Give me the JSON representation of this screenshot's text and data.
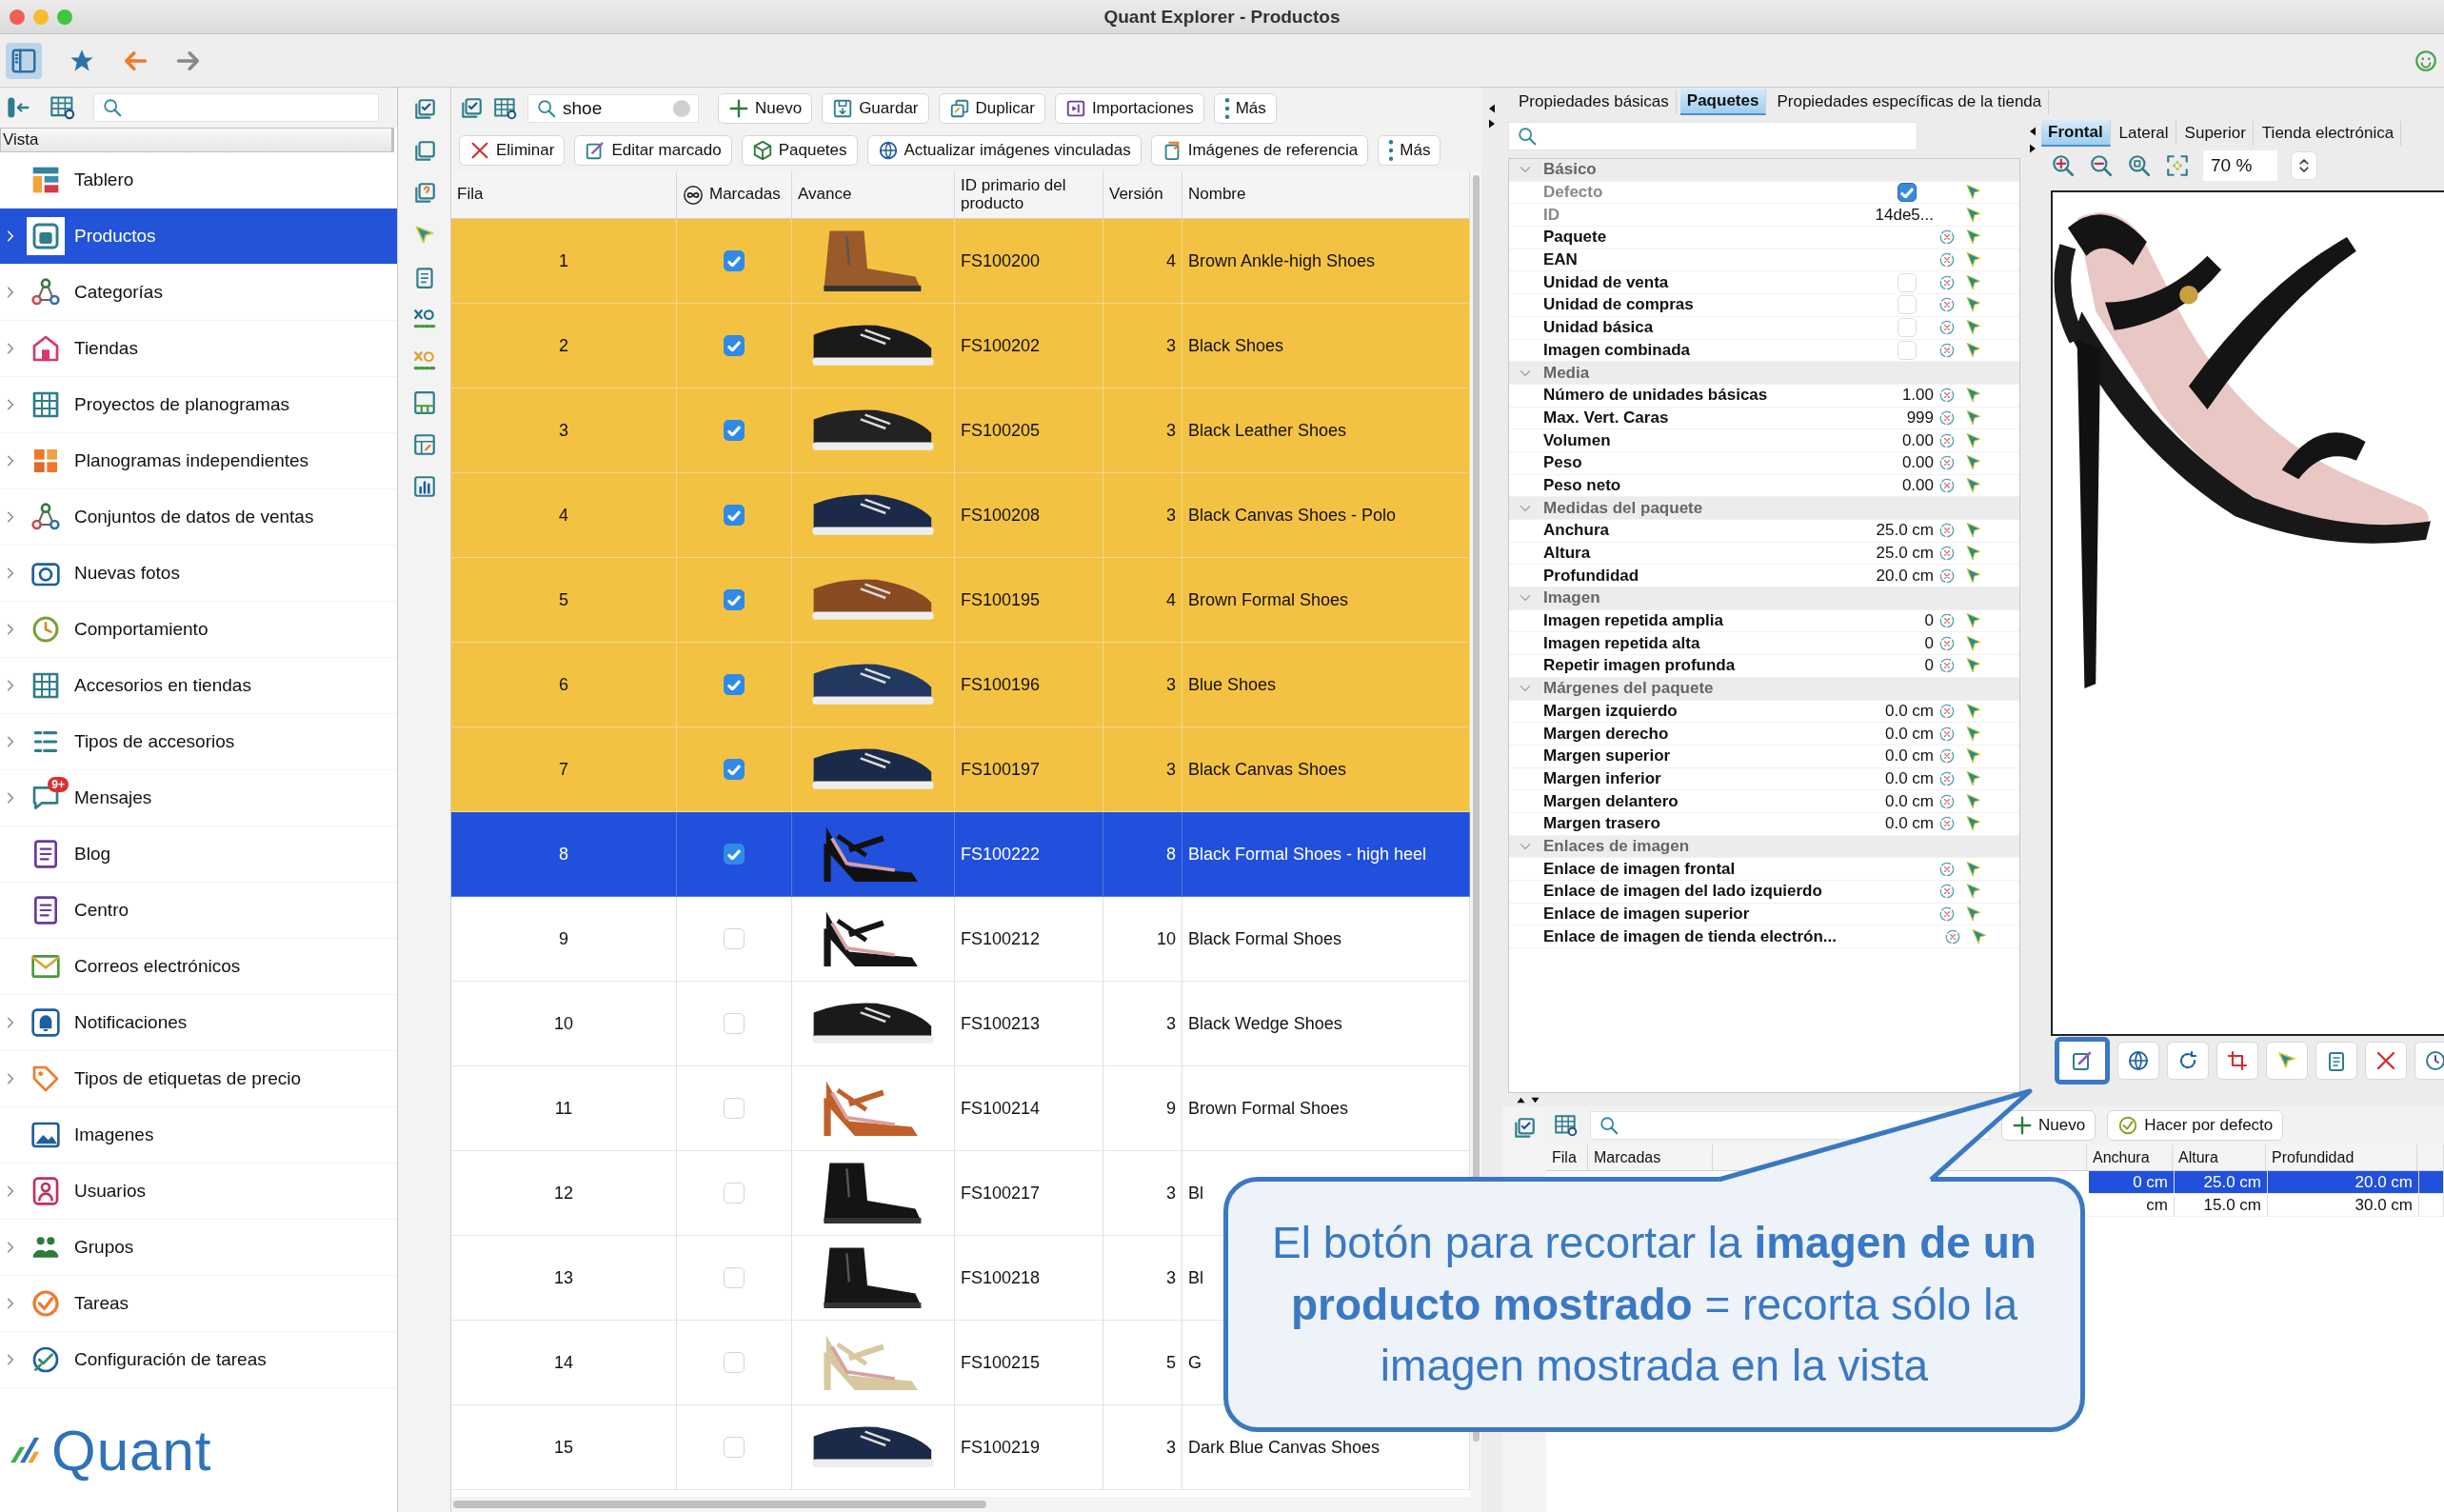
{
  "window": {
    "title": "Quant Explorer - Productos"
  },
  "sidebar": {
    "header": "Vista",
    "items": [
      {
        "label": "Tablero",
        "selected": false,
        "expandable": false
      },
      {
        "label": "Productos",
        "selected": true,
        "expandable": true
      },
      {
        "label": "Categorías",
        "selected": false,
        "expandable": true
      },
      {
        "label": "Tiendas",
        "selected": false,
        "expandable": true
      },
      {
        "label": "Proyectos de planogramas",
        "selected": false,
        "expandable": true
      },
      {
        "label": "Planogramas independientes",
        "selected": false,
        "expandable": true
      },
      {
        "label": "Conjuntos de datos de ventas",
        "selected": false,
        "expandable": true
      },
      {
        "label": "Nuevas fotos",
        "selected": false,
        "expandable": true
      },
      {
        "label": "Comportamiento",
        "selected": false,
        "expandable": true
      },
      {
        "label": "Accesorios en tiendas",
        "selected": false,
        "expandable": true
      },
      {
        "label": "Tipos de accesorios",
        "selected": false,
        "expandable": true
      },
      {
        "label": "Mensajes",
        "selected": false,
        "expandable": true,
        "badge": "9+"
      },
      {
        "label": "Blog",
        "selected": false,
        "expandable": false
      },
      {
        "label": "Centro",
        "selected": false,
        "expandable": false
      },
      {
        "label": "Correos electrónicos",
        "selected": false,
        "expandable": false
      },
      {
        "label": "Notificaciones",
        "selected": false,
        "expandable": true
      },
      {
        "label": "Tipos de etiquetas de precio",
        "selected": false,
        "expandable": true
      },
      {
        "label": "Imagenes",
        "selected": false,
        "expandable": false
      },
      {
        "label": "Usuarios",
        "selected": false,
        "expandable": true
      },
      {
        "label": "Grupos",
        "selected": false,
        "expandable": true
      },
      {
        "label": "Tareas",
        "selected": false,
        "expandable": true
      },
      {
        "label": "Configuración de tareas",
        "selected": false,
        "expandable": true
      }
    ],
    "logo": "Quant"
  },
  "products": {
    "search": {
      "value": "shoe"
    },
    "toolbar_1": [
      "Nuevo",
      "Guardar",
      "Duplicar",
      "Importaciones",
      "Más"
    ],
    "toolbar_2": [
      "Eliminar",
      "Editar marcado",
      "Paquetes",
      "Actualizar imágenes vinculadas",
      "Imágenes de referencia",
      "Más"
    ],
    "columns": [
      "Fila",
      "Marcadas",
      "Avance",
      "ID primario del producto",
      "Versión",
      "Nombre"
    ],
    "rows": [
      {
        "fila": "1",
        "marked": true,
        "selected": false,
        "id": "FS100200",
        "version": "4",
        "name": "Brown Ankle-high Shoes"
      },
      {
        "fila": "2",
        "marked": true,
        "selected": false,
        "id": "FS100202",
        "version": "3",
        "name": "Black Shoes"
      },
      {
        "fila": "3",
        "marked": true,
        "selected": false,
        "id": "FS100205",
        "version": "3",
        "name": "Black Leather Shoes"
      },
      {
        "fila": "4",
        "marked": true,
        "selected": false,
        "id": "FS100208",
        "version": "3",
        "name": "Black Canvas Shoes - Polo"
      },
      {
        "fila": "5",
        "marked": true,
        "selected": false,
        "id": "FS100195",
        "version": "4",
        "name": "Brown Formal Shoes"
      },
      {
        "fila": "6",
        "marked": true,
        "selected": false,
        "id": "FS100196",
        "version": "3",
        "name": "Blue Shoes"
      },
      {
        "fila": "7",
        "marked": true,
        "selected": false,
        "id": "FS100197",
        "version": "3",
        "name": "Black Canvas Shoes"
      },
      {
        "fila": "8",
        "marked": true,
        "selected": true,
        "id": "FS100222",
        "version": "8",
        "name": "Black Formal Shoes - high heel"
      },
      {
        "fila": "9",
        "marked": false,
        "selected": false,
        "id": "FS100212",
        "version": "10",
        "name": "Black Formal Shoes"
      },
      {
        "fila": "10",
        "marked": false,
        "selected": false,
        "id": "FS100213",
        "version": "3",
        "name": "Black Wedge Shoes"
      },
      {
        "fila": "11",
        "marked": false,
        "selected": false,
        "id": "FS100214",
        "version": "9",
        "name": "Brown Formal Shoes"
      },
      {
        "fila": "12",
        "marked": false,
        "selected": false,
        "id": "FS100217",
        "version": "3",
        "name": "Bl"
      },
      {
        "fila": "13",
        "marked": false,
        "selected": false,
        "id": "FS100218",
        "version": "3",
        "name": "Bl"
      },
      {
        "fila": "14",
        "marked": false,
        "selected": false,
        "id": "FS100215",
        "version": "5",
        "name": "G"
      },
      {
        "fila": "15",
        "marked": false,
        "selected": false,
        "id": "FS100219",
        "version": "3",
        "name": "Dark Blue Canvas Shoes"
      }
    ]
  },
  "properties": {
    "tabs": [
      {
        "label": "Propiedades básicas",
        "selected": false
      },
      {
        "label": "Paquetes",
        "selected": true
      },
      {
        "label": "Propiedades específicas de la tienda",
        "selected": false
      }
    ],
    "groups": [
      {
        "label": "Básico",
        "expanded": true,
        "rows": [
          {
            "label": "Defecto",
            "kind": "checkbox",
            "checked": true,
            "disabled": true
          },
          {
            "label": "ID",
            "kind": "text",
            "value": "14de5...",
            "disabled": true
          },
          {
            "label": "Paquete",
            "kind": "text",
            "disabled": false
          },
          {
            "label": "EAN",
            "kind": "text",
            "disabled": false
          },
          {
            "label": "Unidad de venta",
            "kind": "checkbox",
            "checked": false,
            "disabled": false
          },
          {
            "label": "Unidad de compras",
            "kind": "checkbox",
            "checked": false,
            "disabled": false
          },
          {
            "label": "Unidad básica",
            "kind": "checkbox",
            "checked": false,
            "disabled": false
          },
          {
            "label": "Imagen combinada",
            "kind": "checkbox",
            "checked": false,
            "disabled": false
          }
        ]
      },
      {
        "label": "Media",
        "expanded": true,
        "rows": [
          {
            "label": "Número de unidades básicas",
            "kind": "text",
            "value": "1.00",
            "disabled": false
          },
          {
            "label": "Max. Vert. Caras",
            "kind": "text",
            "value": "999",
            "disabled": false
          },
          {
            "label": "Volumen",
            "kind": "text",
            "value": "0.00",
            "disabled": false
          },
          {
            "label": "Peso",
            "kind": "text",
            "value": "0.00",
            "disabled": false
          },
          {
            "label": "Peso neto",
            "kind": "text",
            "value": "0.00",
            "disabled": false
          }
        ]
      },
      {
        "label": "Medidas del paquete",
        "expanded": true,
        "rows": [
          {
            "label": "Anchura",
            "kind": "text",
            "value": "25.0 cm",
            "disabled": false
          },
          {
            "label": "Altura",
            "kind": "text",
            "value": "25.0 cm",
            "disabled": false
          },
          {
            "label": "Profundidad",
            "kind": "text",
            "value": "20.0 cm",
            "disabled": false
          }
        ]
      },
      {
        "label": "Imagen",
        "expanded": true,
        "rows": [
          {
            "label": "Imagen repetida amplia",
            "kind": "text",
            "value": "0",
            "disabled": false
          },
          {
            "label": "Imagen repetida alta",
            "kind": "text",
            "value": "0",
            "disabled": false
          },
          {
            "label": "Repetir imagen profunda",
            "kind": "text",
            "value": "0",
            "disabled": false
          }
        ]
      },
      {
        "label": "Márgenes del paquete",
        "expanded": true,
        "rows": [
          {
            "label": "Margen izquierdo",
            "kind": "text",
            "value": "0.0 cm",
            "disabled": false
          },
          {
            "label": "Margen derecho",
            "kind": "text",
            "value": "0.0 cm",
            "disabled": false
          },
          {
            "label": "Margen superior",
            "kind": "text",
            "value": "0.0 cm",
            "disabled": false
          },
          {
            "label": "Margen inferior",
            "kind": "text",
            "value": "0.0 cm",
            "disabled": false
          },
          {
            "label": "Margen delantero",
            "kind": "text",
            "value": "0.0 cm",
            "disabled": false
          },
          {
            "label": "Margen trasero",
            "kind": "text",
            "value": "0.0 cm",
            "disabled": false
          }
        ]
      },
      {
        "label": "Enlaces de imagen",
        "expanded": true,
        "rows": [
          {
            "label": "Enlace de imagen frontal",
            "kind": "text",
            "disabled": false
          },
          {
            "label": "Enlace de imagen del lado izquierdo",
            "kind": "text",
            "disabled": false
          },
          {
            "label": "Enlace de imagen superior",
            "kind": "text",
            "disabled": false
          },
          {
            "label": "Enlace de imagen de tienda electrón...",
            "kind": "text",
            "disabled": false
          }
        ]
      }
    ]
  },
  "preview": {
    "tabs": [
      {
        "label": "Frontal",
        "selected": true
      },
      {
        "label": "Lateral",
        "selected": false
      },
      {
        "label": "Superior",
        "selected": false
      },
      {
        "label": "Tienda electrónica",
        "selected": false
      }
    ],
    "zoom": "70 %",
    "buttons": [
      {
        "highlighted": true
      },
      {
        "highlighted": false
      },
      {
        "highlighted": false
      },
      {
        "highlighted": false
      },
      {
        "highlighted": false
      },
      {
        "highlighted": false
      },
      {
        "highlighted": false
      },
      {
        "highlighted": false
      }
    ]
  },
  "packages": {
    "toolbar": [
      "Nuevo",
      "Hacer por defecto"
    ],
    "columns": [
      {
        "label": "Fila",
        "kind": "text"
      },
      {
        "label": "Marcadas",
        "kind": "text"
      },
      {
        "kind": "blank"
      },
      {
        "label": "Anchura",
        "kind": "text"
      },
      {
        "label": "Altura",
        "kind": "text"
      },
      {
        "label": "Profundidad",
        "kind": "text"
      }
    ],
    "rows": [
      {
        "selected": true,
        "cells": [
          "0 cm",
          "25.0 cm",
          "20.0 cm"
        ]
      },
      {
        "selected": false,
        "cells": [
          "cm",
          "15.0 cm",
          "30.0 cm"
        ]
      }
    ]
  },
  "callout": {
    "text": "El botón para recortar la **imagen de un producto mostrado** = recorta sólo la imagen mostrada en la vista"
  }
}
